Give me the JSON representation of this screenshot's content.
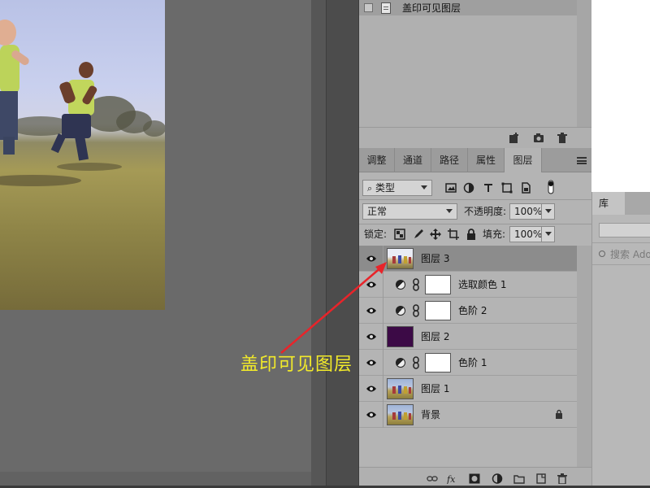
{
  "history": {
    "item_label": "盖印可见图层"
  },
  "tabs": [
    {
      "label": "调整"
    },
    {
      "label": "通道"
    },
    {
      "label": "路径"
    },
    {
      "label": "属性"
    },
    {
      "label": "图层"
    }
  ],
  "layers_panel": {
    "filter_kind": "类型",
    "blend_mode": "正常",
    "opacity_label": "不透明度:",
    "opacity_value": "100%",
    "lock_label": "锁定:",
    "fill_label": "填充:",
    "fill_value": "100%",
    "layers": [
      {
        "name": "图层 3",
        "type": "pixel",
        "thumbnail": "photo",
        "selected": true
      },
      {
        "name": "选取颜色 1",
        "type": "adjustment"
      },
      {
        "name": "色阶 2",
        "type": "adjustment"
      },
      {
        "name": "图层 2",
        "type": "pixel",
        "thumbnail": "solid",
        "thumbnail_color": "#3c0a46"
      },
      {
        "name": "色阶 1",
        "type": "adjustment"
      },
      {
        "name": "图层 1",
        "type": "pixel",
        "thumbnail": "photo"
      },
      {
        "name": "背景",
        "type": "background",
        "thumbnail": "photo",
        "locked": true
      }
    ]
  },
  "library": {
    "tab_label": "库",
    "search_placeholder": "搜索 Adob"
  },
  "annotation": {
    "text": "盖印可见图层",
    "color": "#f2ea2a"
  },
  "icons": {
    "visibility": "eye-icon",
    "adjustment": "half-circle-icon",
    "link": "chain-icon",
    "lock": "lock-icon"
  }
}
